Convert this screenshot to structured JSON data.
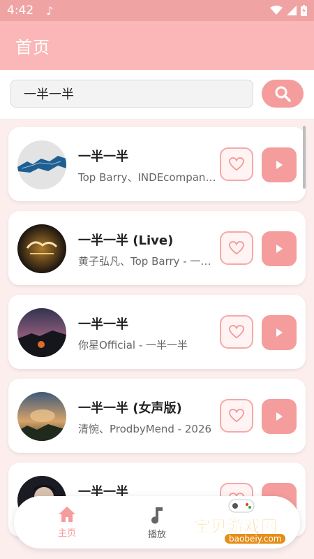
{
  "status": {
    "time": "4:42"
  },
  "header": {
    "title": "首页"
  },
  "search": {
    "value": "一半一半"
  },
  "songs": [
    {
      "title": "一半一半",
      "subtitle": "Top Barry、INDEcompany - 一半一半"
    },
    {
      "title": "一半一半 (Live)",
      "subtitle": "黄子弘凡、Top Barry - 一半一半"
    },
    {
      "title": "一半一半",
      "subtitle": "你星Official - 一半一半"
    },
    {
      "title": "一半一半 (女声版)",
      "subtitle": "清惋、ProdbyMend - 2026"
    },
    {
      "title": "一半一半",
      "subtitle": ""
    }
  ],
  "nav": {
    "home": {
      "label": "主页",
      "icon": "home-icon",
      "color": "#f59d9d"
    },
    "play": {
      "label": "播放",
      "icon": "music-note-icon",
      "color": "#666666"
    }
  },
  "watermark": {
    "text": "宝贝游戏网",
    "url": "baobeiy.com"
  },
  "colors": {
    "accent": "#f59d9d",
    "header": "#fbb7b7",
    "statusbar": "#f0a3a3"
  }
}
